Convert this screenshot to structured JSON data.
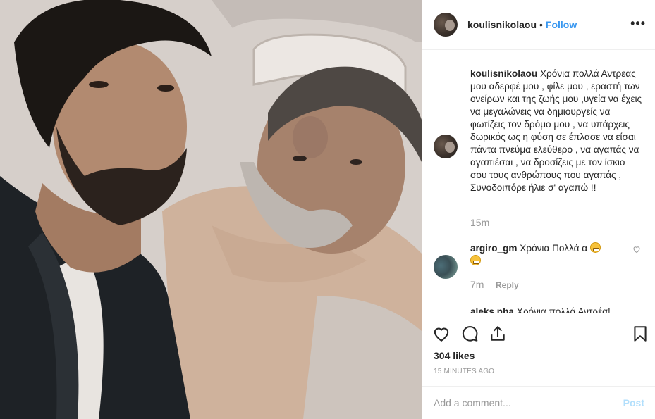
{
  "photo": {
    "description_icon": "photo"
  },
  "header": {
    "username": "koulisnikolaou",
    "separator": "•",
    "follow_label": "Follow",
    "more_label": "•••"
  },
  "caption": {
    "username": "koulisnikolaou",
    "text": "Χρόνια πολλά Αντρεας μου αδερφέ μου , φίλε μου , εραστή των ονείρων και της ζωής μου ,υγεία να έχεις να μεγαλώνεις να δημιουργείς να φωτίζεις τον δρόμο μου , να υπάρχεις δωρικός ως η φύση σε έπλασε να είσαι πάντα πνεύμα ελεύθερο , να αγαπάς να αγαπιέσαι , να δροσίζεις με τον ίσκιο σου τους ανθρώπους που αγαπάς , Συνοδοιπόρε ήλιε σ' αγαπώ !!",
    "time": "15m"
  },
  "comments": [
    {
      "username": "argiro_gm",
      "text": "Χρόνια Πολλά α",
      "emoji": "grinning-face-emoji",
      "time": "7m",
      "reply_label": "Reply"
    },
    {
      "username": "aleks.nha",
      "text": "Χρόνια πολλά Αντρέα!"
    }
  ],
  "actions": {
    "icons": [
      "heart-icon",
      "comment-icon",
      "share-icon",
      "bookmark-icon"
    ],
    "likes": "304 likes",
    "ago": "15 MINUTES AGO"
  },
  "add_comment": {
    "placeholder": "Add a comment...",
    "post_label": "Post"
  },
  "colors": {
    "link": "#3897f0",
    "post_disabled": "#b2dffc",
    "muted": "#999999",
    "text": "#262626"
  }
}
